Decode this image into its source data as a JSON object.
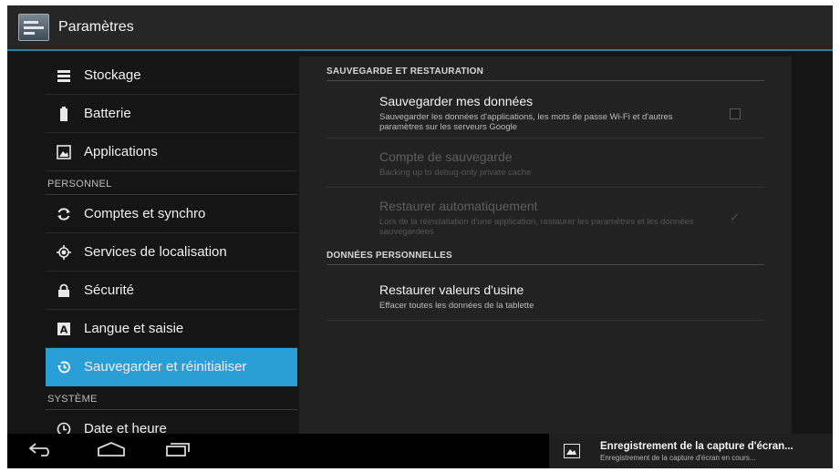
{
  "action_bar": {
    "title": "Paramètres",
    "icon": "settings-app-icon"
  },
  "nav": {
    "items": [
      {
        "label": "Stockage",
        "icon": "storage-icon"
      },
      {
        "label": "Batterie",
        "icon": "battery-icon"
      },
      {
        "label": "Applications",
        "icon": "applications-icon"
      },
      {
        "label": "Comptes et synchro",
        "icon": "sync-icon"
      },
      {
        "label": "Services de localisation",
        "icon": "location-icon"
      },
      {
        "label": "Sécurité",
        "icon": "lock-icon"
      },
      {
        "label": "Langue et saisie",
        "icon": "language-icon"
      },
      {
        "label": "Sauvegarder et réinitialiser",
        "icon": "backup-restore-icon",
        "selected": true
      },
      {
        "label": "Date et heure",
        "icon": "clock-icon"
      }
    ],
    "headers": {
      "personnel": "PERSONNEL",
      "systeme": "SYSTÈME"
    }
  },
  "detail": {
    "backup_section": {
      "header": "SAUVEGARDE ET RESTAURATION",
      "backup_data": {
        "title": "Sauvegarder mes données",
        "summary": "Sauvegarder les données d'applications, les mots de passe Wi-Fi et d'autres paramètres sur les serveurs Google",
        "checked": false
      },
      "backup_account": {
        "title": "Compte de sauvegarde",
        "summary": "Backing up to debug-only private cache",
        "enabled": false
      },
      "auto_restore": {
        "title": "Restaurer automatiquement",
        "summary": "Lors de la réinstallation d'une application, restaurer les paramètres et les données sauvegardées",
        "checked": true,
        "enabled": false
      }
    },
    "personal_section": {
      "header": "DONNÉES PERSONNELLES",
      "factory_reset": {
        "title": "Restaurer valeurs d'usine",
        "summary": "Effacer toutes les données de la tablette"
      }
    }
  },
  "system_bar": {
    "buttons": [
      "back-icon",
      "home-icon",
      "recent-apps-icon"
    ],
    "notification": {
      "title": "Enregistrement de la capture d'écran...",
      "text": "Enregistrement de la capture d'écran en cours..."
    }
  },
  "colors": {
    "accent": "#2a9fd6",
    "background": "#151515",
    "panel": "#222222"
  }
}
